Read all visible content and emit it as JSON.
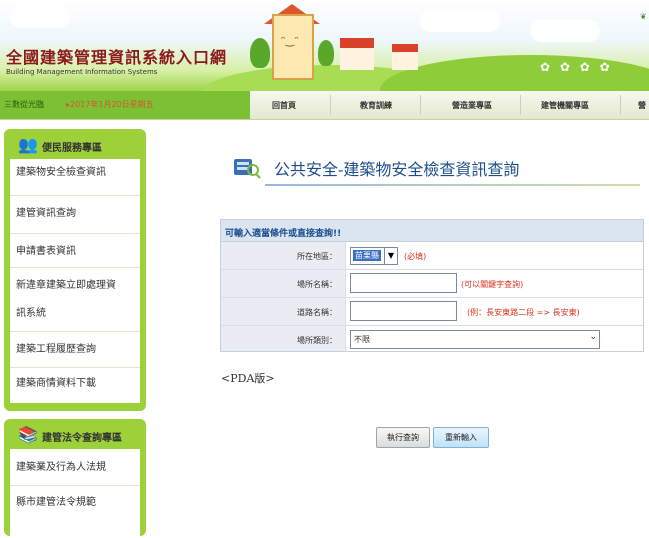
{
  "header": {
    "title": "全國建築管理資訊系統入口網",
    "subtitle": "Building Management Information Systems"
  },
  "navbar": {
    "greeting": "三數從光臨",
    "date": "▸2017年1月20日星期五",
    "items": [
      "回首頁",
      "教育訓練",
      "營造業專區",
      "建管機關專區",
      "營"
    ]
  },
  "sidebar": {
    "panel1": {
      "title": "便民服務專區",
      "items": [
        "建築物安全檢查資訊",
        "建管資訊查詢",
        "申請書表資訊",
        "新違章建築立即處理資",
        "訊系統",
        "建築工程履歷查詢",
        "建築商情資料下載"
      ]
    },
    "panel2": {
      "title": "建管法令查詢專區",
      "items": [
        "建築業及行為人法規",
        "縣市建管法令規範"
      ]
    }
  },
  "page": {
    "title": "公共安全-建築物安全檢查資訊查詢"
  },
  "form": {
    "header": "可輸入適當條件或直接查詢!!",
    "area_label": "所在地區：",
    "area_value": "苗栗縣",
    "area_hint": "(必填)",
    "place_label": "場所名稱：",
    "place_hint": "(可以關鍵字查詢)",
    "road_label": "道路名稱：",
    "road_hint": "(例：長安東路二段 => 長安東)",
    "type_label": "場所類別：",
    "type_value": "不限"
  },
  "pda_link": "<PDA版>",
  "buttons": {
    "query": "執行查詢",
    "reset": "重新輸入"
  },
  "colors": {
    "sidebar_green": "#9dd13a",
    "title_blue": "#1c4e8a",
    "hint_red": "#d9331f",
    "site_title_red": "#8b1a1a"
  }
}
